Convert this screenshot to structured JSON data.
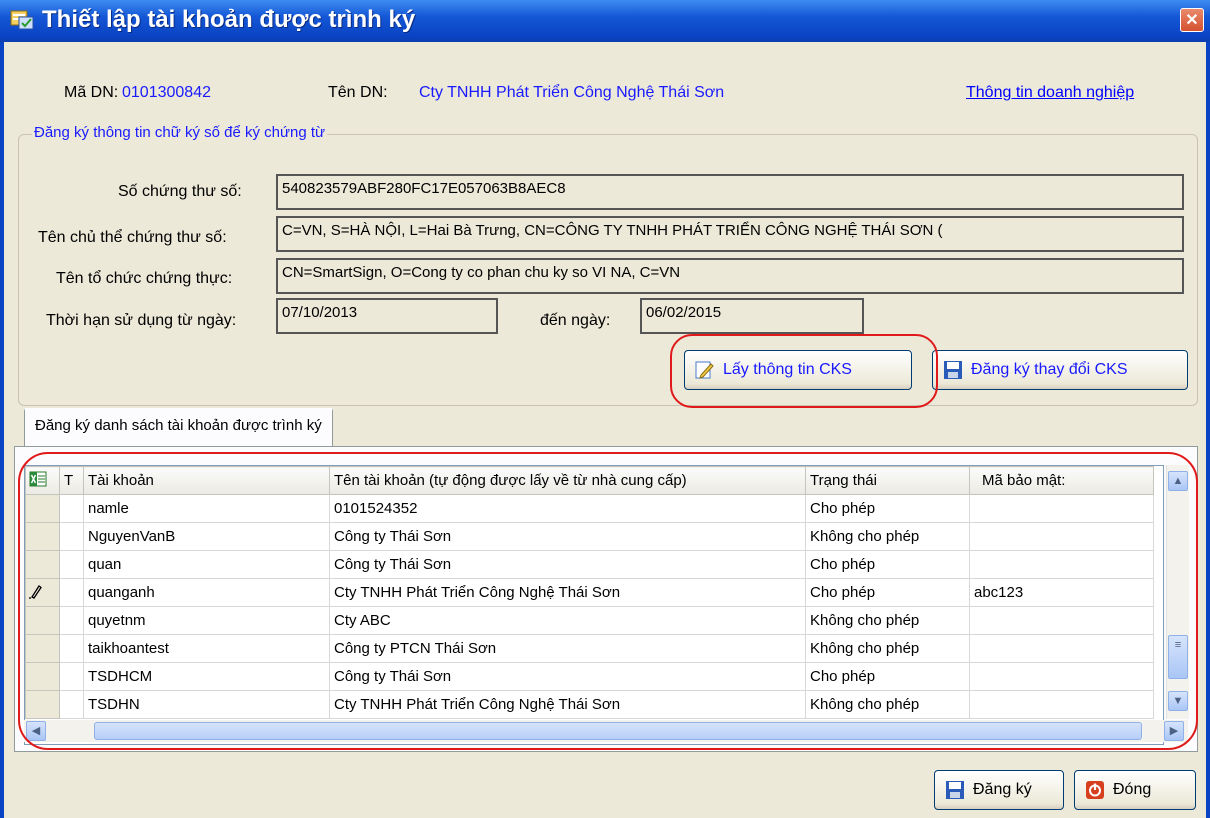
{
  "window": {
    "title": "Thiết lập tài khoản được trình ký",
    "close_symbol": "✕"
  },
  "company": {
    "code_label": "Mã DN:",
    "code_value": "0101300842",
    "name_label": "Tên DN:",
    "name_value": "Cty TNHH Phát Triển Công Nghệ Thái Sơn",
    "info_link": "Thông tin doanh nghiệp"
  },
  "signature_group": {
    "title": "Đăng ký thông tin chữ ký số để ký chứng từ",
    "cert_serial_label": "Số chứng thư số:",
    "cert_serial_value": "540823579ABF280FC17E057063B8AEC8",
    "subject_label": "Tên chủ thể chứng thư số:",
    "subject_value": "C=VN, S=HÀ NỘI, L=Hai Bà Trưng, CN=CÔNG TY TNHH PHÁT TRIỂN CÔNG NGHỆ THÁI SƠN (",
    "issuer_label": "Tên tổ chức chứng thực:",
    "issuer_value": "CN=SmartSign, O=Cong ty co phan chu ky so VI NA, C=VN",
    "valid_from_label": "Thời hạn sử dụng từ ngày:",
    "valid_from_value": "07/10/2013",
    "valid_to_label": "đến ngày:",
    "valid_to_value": "06/02/2015",
    "get_info_button": "Lấy thông tin CKS",
    "register_change_button": "Đăng ký thay đổi CKS"
  },
  "tabs": [
    {
      "label": "Đăng ký danh sách tài khoản được trình ký"
    }
  ],
  "grid": {
    "columns": [
      "T",
      "Tài khoản",
      "Tên tài khoản (tự động được lấy về từ nhà cung cấp)",
      "Trạng thái",
      "Mã bảo mật:"
    ],
    "rows": [
      {
        "account": "namle",
        "name": "0101524352",
        "status": "Cho phép",
        "code": ""
      },
      {
        "account": "NguyenVanB",
        "name": "Công ty Thái Sơn",
        "status": "Không cho phép",
        "code": ""
      },
      {
        "account": "quan",
        "name": "Công ty Thái Sơn",
        "status": "Cho phép",
        "code": ""
      },
      {
        "account": "quanganh",
        "name": "Cty TNHH Phát Triển Công Nghệ Thái Sơn",
        "status": "Cho phép",
        "code": "abc123"
      },
      {
        "account": "quyetnm",
        "name": "Cty ABC",
        "status": "Không cho phép",
        "code": ""
      },
      {
        "account": "taikhoantest",
        "name": "Công ty PTCN Thái Sơn",
        "status": "Không cho phép",
        "code": ""
      },
      {
        "account": "TSDHCM",
        "name": "Công ty Thái Sơn",
        "status": "Cho phép",
        "code": ""
      },
      {
        "account": "TSDHN",
        "name": "Cty TNHH Phát Triển Công Nghệ Thái Sơn",
        "status": "Không cho phép",
        "code": ""
      }
    ],
    "editing_row_icon": "pencil-icon"
  },
  "footer": {
    "register_button": "Đăng ký",
    "close_button": "Đóng"
  },
  "colors": {
    "title_bar": "#0a44c4",
    "label_blue": "#1a1aff",
    "highlight_ring": "#e01a1a",
    "dialog_bg": "#ece9d8"
  }
}
